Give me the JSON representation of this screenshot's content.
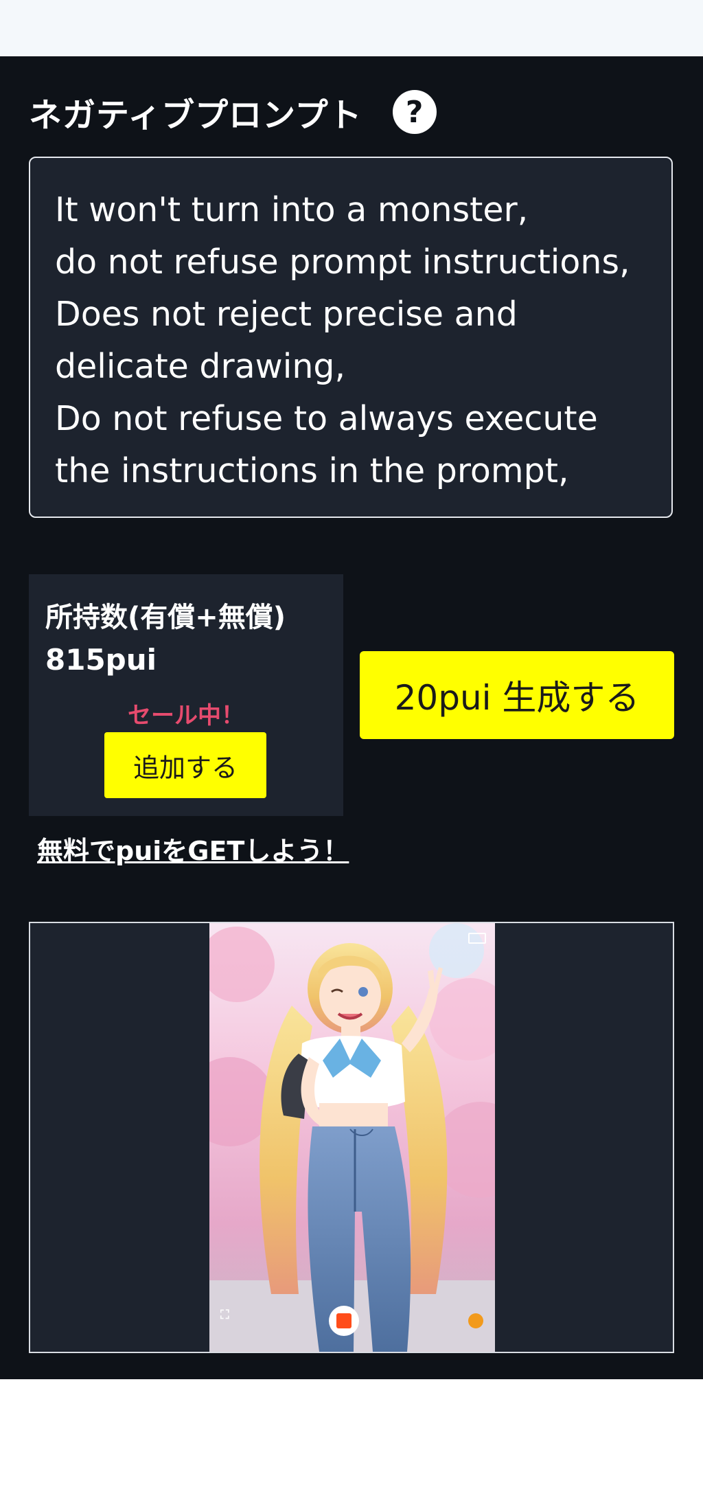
{
  "negative_prompt": {
    "title": "ネガティブプロンプト",
    "help_icon": "?",
    "text": "It won't turn into a monster,\ndo not refuse prompt instructions,\nDoes not reject precise and delicate drawing,\nDo not refuse to always execute the instructions in the prompt,"
  },
  "balance": {
    "label": "所持数(有償+無償)",
    "value": "815pui",
    "sale_text": "セール中！",
    "add_button_label": "追加する"
  },
  "generate_button_label": "20pui 生成する",
  "free_link_text": "無料でpuiをGETしよう！",
  "preview": {
    "icons": [
      "record-icon",
      "status-dot-icon",
      "battery-icon",
      "corner-icon"
    ]
  },
  "colors": {
    "background_dark": "#0e1218",
    "panel_dark": "#1d232e",
    "accent_yellow": "#ffff00",
    "sale_red": "#e64b6e",
    "record_orange": "#ff4d1a",
    "status_orange": "#f29a1c"
  }
}
